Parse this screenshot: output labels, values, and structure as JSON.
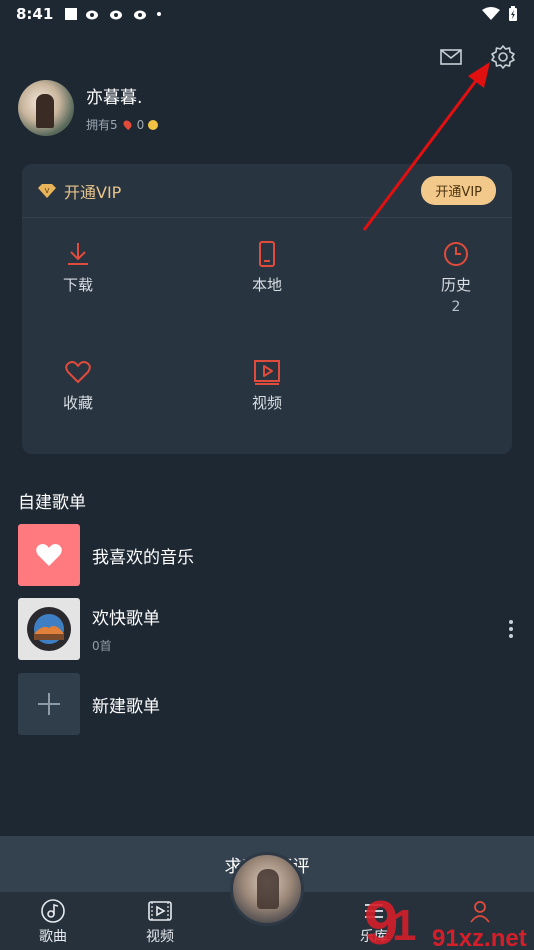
{
  "status_bar": {
    "time": "8:41"
  },
  "header": {
    "mail_icon": "mail-icon",
    "settings_icon": "gear-icon"
  },
  "profile": {
    "username": "亦暮暮.",
    "owned_label": "拥有5",
    "pins": "0"
  },
  "vip": {
    "title": "开通VIP",
    "button": "开通VIP"
  },
  "grid": [
    {
      "label": "下载",
      "icon": "download-icon"
    },
    {
      "label": "本地",
      "icon": "phone-icon"
    },
    {
      "label": "历史",
      "sub": "2",
      "icon": "clock-icon"
    },
    {
      "label": "收藏",
      "icon": "heart-icon"
    },
    {
      "label": "视频",
      "icon": "video-icon"
    }
  ],
  "playlists_section": {
    "title": "自建歌单"
  },
  "playlists": [
    {
      "name": "我喜欢的音乐"
    },
    {
      "name": "欢快歌单",
      "count": "0首"
    },
    {
      "name": "新建歌单"
    }
  ],
  "review_bar": {
    "text": "求五星好评"
  },
  "bottom_nav": [
    {
      "label": "歌曲"
    },
    {
      "label": "视频"
    },
    {
      "label": "乐库"
    }
  ],
  "watermark": {
    "text": "91xz.net"
  },
  "colors": {
    "accent": "#e14b3b",
    "vip_gold": "#f2c98a",
    "background": "#1e2833"
  }
}
